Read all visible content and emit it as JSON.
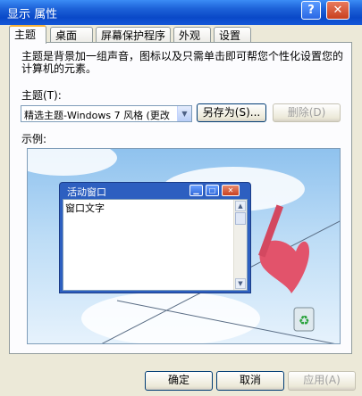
{
  "window": {
    "title": "显示 属性",
    "help": "?",
    "close": "✕"
  },
  "tabs": [
    {
      "label": "主题",
      "active": true
    },
    {
      "label": "桌面"
    },
    {
      "label": "屏幕保护程序"
    },
    {
      "label": "外观"
    },
    {
      "label": "设置"
    }
  ],
  "themes_tab": {
    "description": "主题是背景加一组声音，图标以及只需单击即可帮您个性化设置您的计算机的元素。",
    "theme_label": "主题(T):",
    "theme_value": "精选主题-Windows 7 风格 (更改",
    "save_as": "另存为(S)...",
    "delete": "删除(D)",
    "sample_label": "示例:"
  },
  "preview": {
    "window_title": "活动窗口",
    "window_text": "窗口文字",
    "min": "▁",
    "max": "□",
    "close": "✕"
  },
  "footer": {
    "ok": "确定",
    "cancel": "取消",
    "apply": "应用(A)"
  },
  "colors": {
    "titlebar": "#0a49c8",
    "face": "#ece9d8",
    "close": "#c8401f",
    "tab_highlight": "#f7b23b",
    "heart": "#e2536b"
  }
}
